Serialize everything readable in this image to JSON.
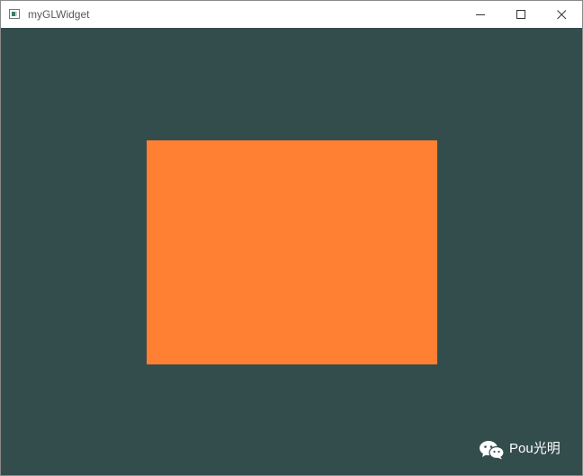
{
  "window": {
    "title": "myGLWidget",
    "controls": {
      "minimize": "minimize",
      "maximize": "maximize",
      "close": "close"
    }
  },
  "gl_widget": {
    "clear_color": "#334d4d",
    "rectangle_color": "#ff8033"
  },
  "watermark": {
    "text": "Pou光明",
    "icon": "wechat-icon"
  }
}
